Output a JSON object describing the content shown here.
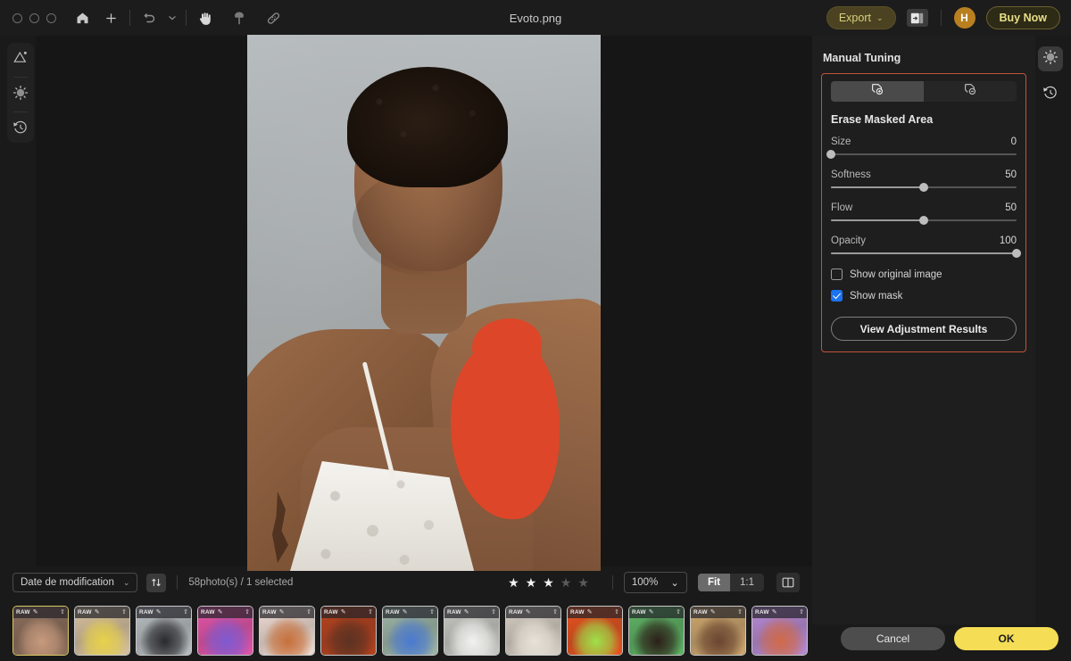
{
  "window": {
    "title": "Evoto.png"
  },
  "toolbar": {
    "home_icon": "home-icon",
    "add_icon": "plus-icon",
    "undo_icon": "undo-arrow-icon",
    "undo_dropdown_icon": "chevron-down-icon",
    "hand_icon": "hand-tool-icon",
    "brush_icon": "brush-tool-icon",
    "heal_icon": "healing-bandage-icon",
    "export_label": "Export",
    "export_chevron": "⌄",
    "panel_toggle_icon": "panel-toggle-icon",
    "avatar_initial": "H",
    "buy_label": "Buy Now"
  },
  "left_rail": {
    "items": [
      {
        "name": "photo-adjust-icon",
        "label": "Photo"
      },
      {
        "name": "retouch-icon",
        "label": "Retouch"
      },
      {
        "name": "history-icon",
        "label": "History"
      }
    ]
  },
  "right_rail": {
    "items": [
      {
        "name": "retouch-icon",
        "active": true
      },
      {
        "name": "history-icon",
        "active": false
      }
    ]
  },
  "panel": {
    "heading": "Manual Tuning",
    "tabs": [
      {
        "icon": "add-mask-icon",
        "active": true
      },
      {
        "icon": "erase-mask-icon",
        "active": false
      }
    ],
    "section_title": "Erase Masked Area",
    "sliders": [
      {
        "label": "Size",
        "value": "0",
        "percent": 0
      },
      {
        "label": "Softness",
        "value": "50",
        "percent": 50
      },
      {
        "label": "Flow",
        "value": "50",
        "percent": 50
      },
      {
        "label": "Opacity",
        "value": "100",
        "percent": 100
      }
    ],
    "checkboxes": [
      {
        "label": "Show original image",
        "checked": false
      },
      {
        "label": "Show mask",
        "checked": true
      }
    ],
    "view_results_label": "View Adjustment Results",
    "accent_border": "#c0543a"
  },
  "bottom_bar": {
    "sort_value": "Date de modification",
    "sort_chevron": "⌄",
    "sort_direction_icon": "sort-direction-icon",
    "photo_count": "58photo(s) / 1 selected",
    "rating": {
      "filled": 3,
      "total": 5
    },
    "zoom_value": "100%",
    "zoom_chevron": "⌄",
    "fit_label": "Fit",
    "one_to_one_label": "1:1",
    "fit_active": true,
    "compare_icon": "compare-split-icon"
  },
  "filmstrip": {
    "badge": "RAW",
    "edit_icon": "pencil-icon",
    "upload_icon": "upload-icon",
    "thumbnails": [
      {
        "id": "thumb-1",
        "selected": true,
        "bg": "#8d6f5c",
        "accent": "#c79a7d",
        "has_upload": true
      },
      {
        "id": "thumb-2",
        "selected": false,
        "bg": "#d8c2a0",
        "accent": "#e8d24a",
        "has_upload": true
      },
      {
        "id": "thumb-3",
        "selected": false,
        "bg": "#b9bfc2",
        "accent": "#2a2a2e",
        "has_upload": true
      },
      {
        "id": "thumb-4",
        "selected": false,
        "bg": "#e555a8",
        "accent": "#7f5ad0",
        "has_upload": true
      },
      {
        "id": "thumb-5",
        "selected": false,
        "bg": "#f0ddd4",
        "accent": "#c8703a",
        "has_upload": true
      },
      {
        "id": "thumb-6",
        "selected": false,
        "bg": "#b8431f",
        "accent": "#5b3222",
        "has_upload": true
      },
      {
        "id": "thumb-7",
        "selected": false,
        "bg": "#9fb7a8",
        "accent": "#4a7ad0",
        "has_upload": true
      },
      {
        "id": "thumb-8",
        "selected": false,
        "bg": "#c9c9c4",
        "accent": "#f2f2f0",
        "has_upload": true
      },
      {
        "id": "thumb-9",
        "selected": false,
        "bg": "#d6cfc4",
        "accent": "#e8e2d8",
        "has_upload": true
      },
      {
        "id": "thumb-10",
        "selected": false,
        "bg": "#e8531f",
        "accent": "#9fe04a",
        "has_upload": true
      },
      {
        "id": "thumb-11",
        "selected": false,
        "bg": "#5fb566",
        "accent": "#2c1f18",
        "has_upload": true
      },
      {
        "id": "thumb-12",
        "selected": false,
        "bg": "#cfa86f",
        "accent": "#6b4530",
        "has_upload": true
      },
      {
        "id": "thumb-13",
        "selected": false,
        "bg": "#b88bd6",
        "accent": "#d06a4a",
        "has_upload": true
      }
    ]
  },
  "footer": {
    "cancel_label": "Cancel",
    "ok_label": "OK",
    "ok_color": "#f5dd55"
  },
  "canvas": {
    "mask_color": "#dd4628",
    "mask_visible": true
  }
}
